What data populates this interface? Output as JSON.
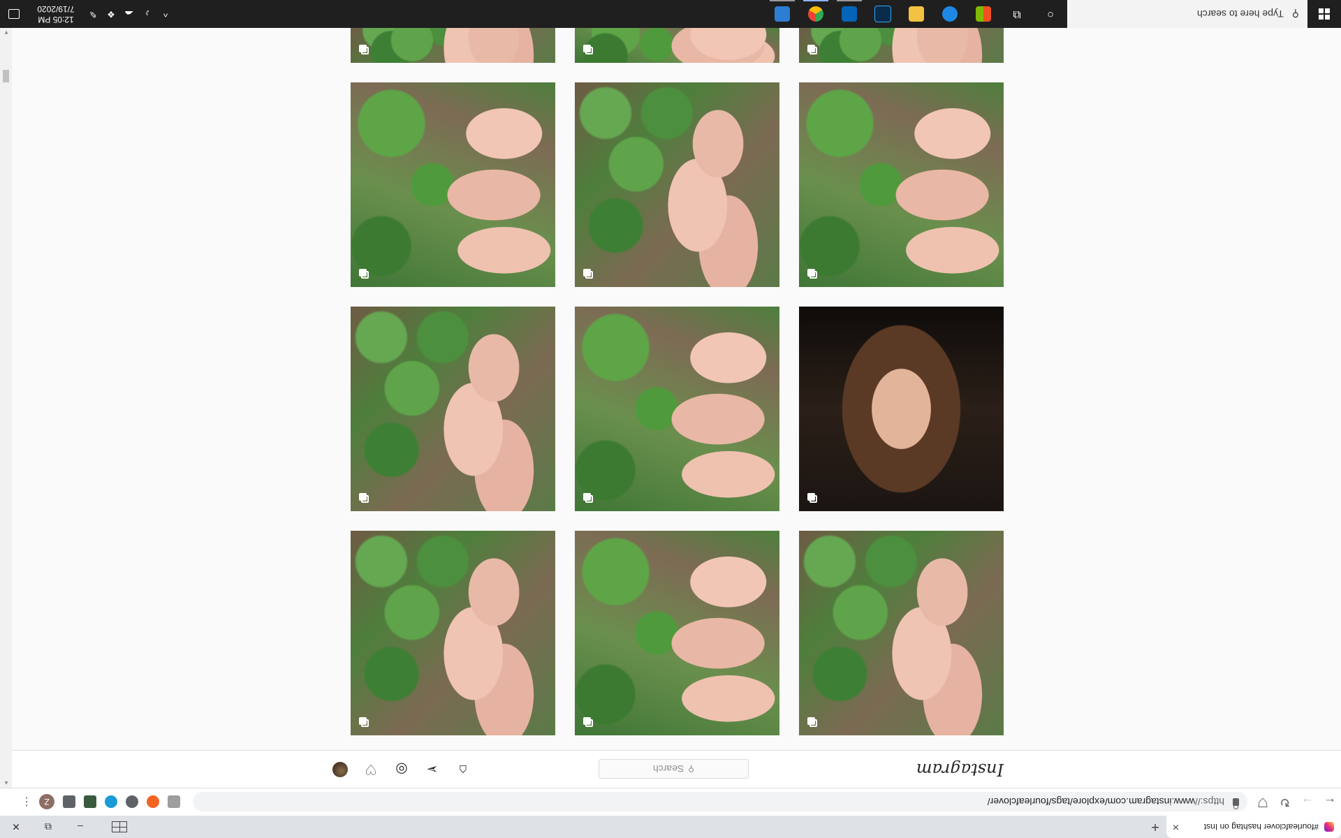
{
  "browser": {
    "tab_title": "#fourleafclover hashtag on Inst",
    "tab_close": "✕",
    "new_tab": "+",
    "window_controls": {
      "minimize": "–",
      "restore": "⧉",
      "close": "✕"
    },
    "url_scheme": "https://",
    "url_rest": "www.instagram.com/explore/tags/fourleafclover/",
    "profile_initial": "Z",
    "menu": "⋮",
    "back": "←",
    "forward": "→",
    "reload": "↻"
  },
  "instagram": {
    "logo": "Instagram",
    "search_placeholder": "Search",
    "search_icon": "⚲",
    "nav_icons": [
      "home-icon",
      "direct-icon",
      "explore-icon",
      "activity-icon",
      "profile-avatar"
    ],
    "tiles": [
      {
        "row": 0,
        "col": 0,
        "kind": "clover",
        "multi": true
      },
      {
        "row": 0,
        "col": 1,
        "kind": "clover-alt",
        "multi": true
      },
      {
        "row": 0,
        "col": 2,
        "kind": "clover",
        "multi": true
      },
      {
        "row": 1,
        "col": 0,
        "kind": "portrait",
        "multi": true
      },
      {
        "row": 1,
        "col": 1,
        "kind": "clover-alt",
        "multi": true
      },
      {
        "row": 1,
        "col": 2,
        "kind": "clover",
        "multi": true
      },
      {
        "row": 2,
        "col": 0,
        "kind": "clover-alt",
        "multi": true
      },
      {
        "row": 2,
        "col": 1,
        "kind": "clover",
        "multi": true
      },
      {
        "row": 2,
        "col": 2,
        "kind": "clover-alt",
        "multi": true
      },
      {
        "row": 3,
        "col": 0,
        "kind": "clover",
        "multi": true
      },
      {
        "row": 3,
        "col": 1,
        "kind": "clover-alt",
        "multi": true
      },
      {
        "row": 3,
        "col": 2,
        "kind": "clover",
        "multi": true
      }
    ]
  },
  "taskbar": {
    "search_placeholder": "Type here to search",
    "clock_time": "12:05 PM",
    "clock_date": "7/19/2020",
    "apps": [
      "cortana-icon",
      "task-view-icon",
      "store-icon",
      "edge-icon",
      "file-explorer-icon",
      "photoshop-icon",
      "onedrive-icon",
      "chrome-icon",
      "control-panel-icon"
    ]
  },
  "colors": {
    "page_bg": "#fafafa",
    "taskbar_bg": "#1f1f1f",
    "accent": "#8ab4f8"
  }
}
